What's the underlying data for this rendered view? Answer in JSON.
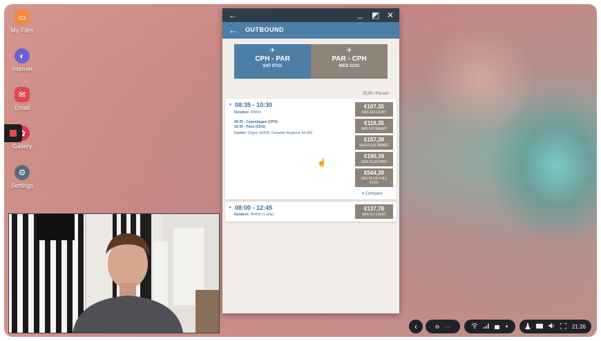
{
  "desktop": {
    "icons": [
      {
        "label": "My Files",
        "icon": "folder-icon",
        "color": "#f08a3c"
      },
      {
        "label": "Internet",
        "icon": "globe-icon",
        "color": "#6b5fd6"
      },
      {
        "label": "Email",
        "icon": "envelope-icon",
        "color": "#e0484f"
      },
      {
        "label": "Gallery",
        "icon": "flower-icon",
        "color": "#d8335a"
      },
      {
        "label": "Settings",
        "icon": "gear-icon",
        "color": "#5c6b78"
      }
    ]
  },
  "window": {
    "controls": {
      "back": "←",
      "minimize": "_",
      "restore": "◩",
      "close": "✕"
    }
  },
  "app": {
    "header_back": "←",
    "header_title": "OUTBOUND",
    "tabs": [
      {
        "plane": "✈",
        "route": "CPH - PAR",
        "date": "SAT 07/11",
        "color": "#4d7ea6"
      },
      {
        "plane": "✈",
        "route": "PAR - CPH",
        "date": "WED 11/11",
        "color": "#8d8378"
      }
    ],
    "unit_label": "EUR / Person",
    "flights": [
      {
        "expand": "▾",
        "time": "08:35 - 10:30",
        "duration_label": "Duration:",
        "duration": "1h55m",
        "departure": "08:35 - Copenhagen (CPH)",
        "arrival": "10:30 - Paris (CDG)",
        "carrier_label": "Carrier:",
        "carrier": "Cityjet, SK565, Canadair Regional Jet 900",
        "fares": [
          {
            "price": "€107,35",
            "name": "SAS GO LIGHT"
          },
          {
            "price": "€118,35",
            "name": "SAS GO SMART"
          },
          {
            "price": "€157,39",
            "name": "SAS PLUS SMART"
          },
          {
            "price": "€190,39",
            "name": "SAS PLUS PRO"
          },
          {
            "price": "€544,39",
            "name": "SAS PLUS FULL FLEX"
          }
        ],
        "compare": "▾ Compare"
      },
      {
        "expand": "▸",
        "time": "08:00 - 12:45",
        "duration_label": "Duration:",
        "duration": "4h45m (1 stop)",
        "fares": [
          {
            "price": "€137,78",
            "name": "SAS GO LIGHT"
          }
        ]
      }
    ]
  },
  "taskbar": {
    "back": "‹",
    "minus": "⊖",
    "more": "···",
    "wifi": "wifi-icon",
    "signal": "signal-icon",
    "lock": "lock-icon",
    "up": "▲",
    "tray": {
      "flask": "flask-icon",
      "keyboard": "keyboard-icon",
      "volume": "volume-icon",
      "screenshot": "screenshot-icon"
    },
    "clock": "21:26"
  }
}
